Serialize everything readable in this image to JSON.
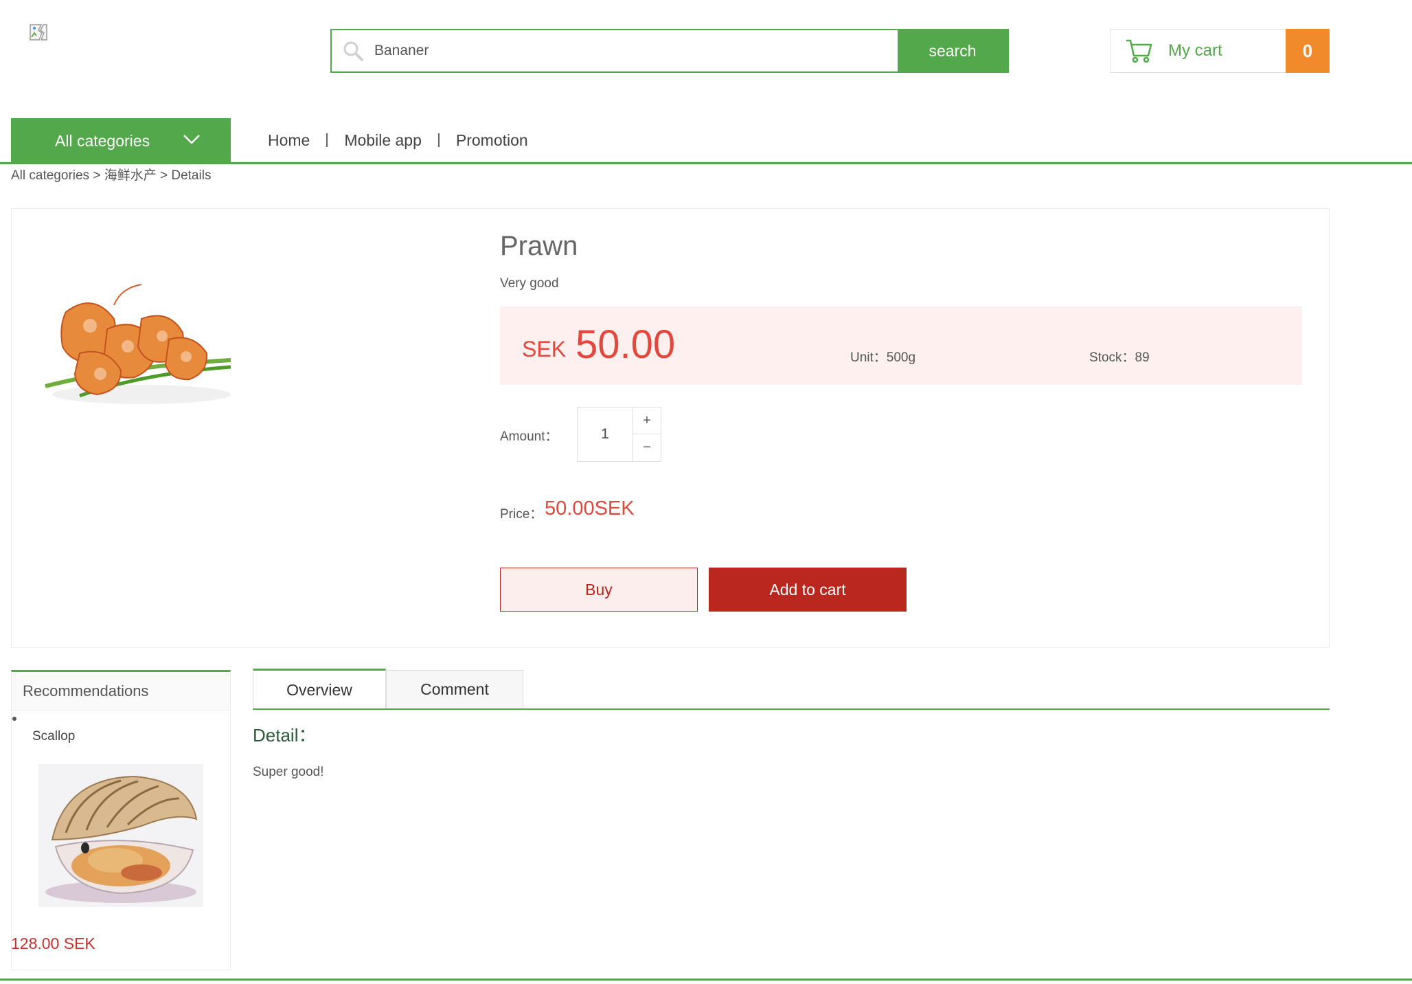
{
  "header": {
    "search": {
      "value": "Bananer",
      "button_label": "search"
    },
    "cart": {
      "label": "My cart",
      "count": "0"
    }
  },
  "nav": {
    "categories_label": "All categories",
    "links": [
      "Home",
      "Mobile app",
      "Promotion"
    ]
  },
  "breadcrumb": "All categories > 海鲜水产 > Details",
  "product": {
    "name": "Prawn",
    "subtitle": "Very good",
    "currency": "SEK",
    "price": "50.00",
    "unit": "Unit：500g",
    "stock": "Stock：89",
    "amount_label": "Amount：",
    "quantity": "1",
    "plus": "+",
    "minus": "−",
    "price_label": "Price：",
    "total_price": "50.00SEK",
    "buy_label": "Buy",
    "add_to_cart_label": "Add to cart"
  },
  "recommendations": {
    "title": "Recommendations",
    "items": [
      {
        "name": "Scallop",
        "price": "128.00 SEK"
      }
    ]
  },
  "tabs": {
    "items": [
      "Overview",
      "Comment"
    ],
    "active": "Overview"
  },
  "detail": {
    "heading": "Detail：",
    "text": "Super good!"
  },
  "colors": {
    "brand_green": "#52a84a",
    "cart_orange": "#f08a2b",
    "price_red": "#e4483d",
    "button_red": "#b9271f"
  },
  "icons": {
    "search": "search-icon",
    "cart": "cart-icon",
    "chevron": "chevron-down-icon",
    "logo": "broken-image-icon"
  }
}
